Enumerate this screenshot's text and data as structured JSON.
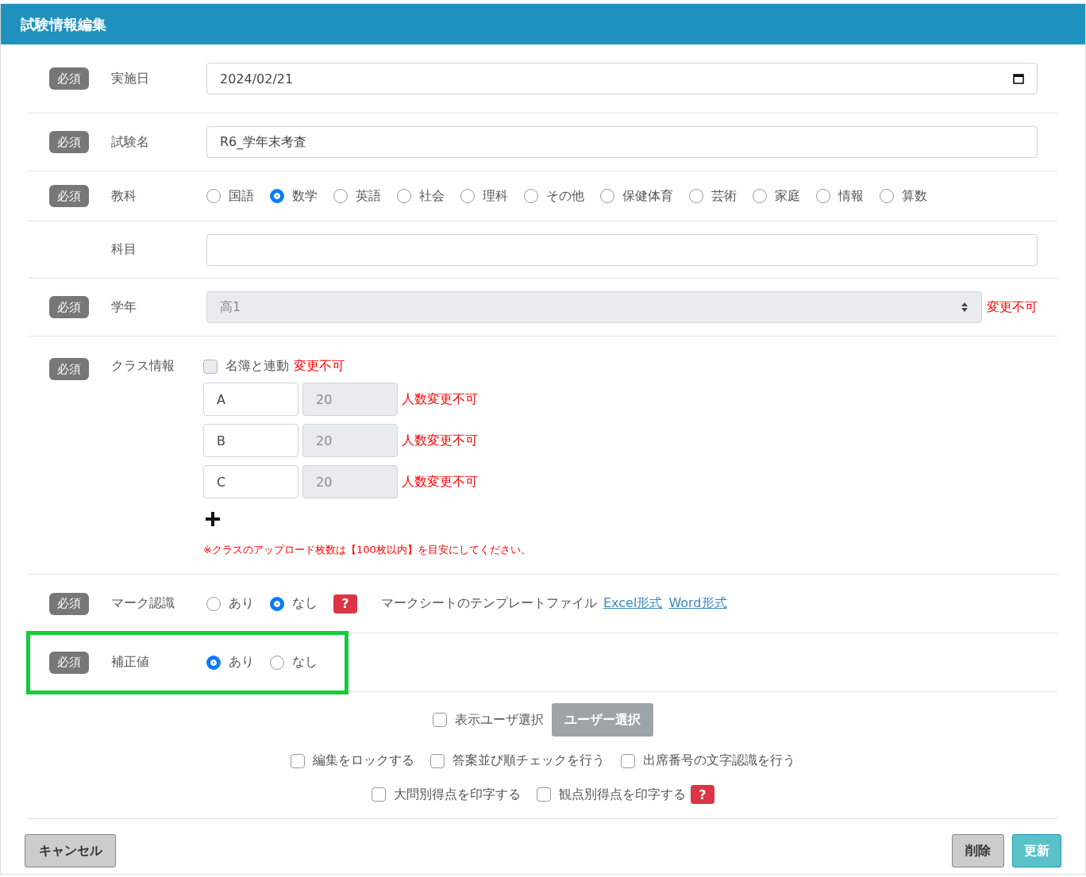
{
  "title": "試験情報編集",
  "fields": [
    {
      "kind": "date",
      "required_label": "必須",
      "label": "実施日",
      "value": "2024/02/21"
    },
    {
      "kind": "text",
      "required_label": "必須",
      "label": "試験名",
      "value": "R6_学年末考査"
    },
    {
      "kind": "radio",
      "required_label": "必須",
      "label": "教科",
      "options": [
        {
          "label": "国語",
          "selected": false
        },
        {
          "label": "数学",
          "selected": true
        },
        {
          "label": "英語",
          "selected": false
        },
        {
          "label": "社会",
          "selected": false
        },
        {
          "label": "理科",
          "selected": false
        },
        {
          "label": "その他",
          "selected": false
        },
        {
          "label": "保健体育",
          "selected": false
        },
        {
          "label": "芸術",
          "selected": false
        },
        {
          "label": "家庭",
          "selected": false
        },
        {
          "label": "情報",
          "selected": false
        },
        {
          "label": "算数",
          "selected": false
        }
      ]
    },
    {
      "kind": "text",
      "label": "科目"
    },
    {
      "kind": "select",
      "required_label": "必須",
      "label": "学年",
      "value": "高1",
      "disabled": true,
      "note": "変更不可"
    },
    {
      "kind": "classes",
      "required_label": "必須",
      "label": "クラス情報",
      "link_checkbox": {
        "label": "名簿と連動",
        "checked": false,
        "disabled": true,
        "note": "変更不可"
      },
      "classes": [
        {
          "name": "A",
          "count": "20",
          "count_disabled": true,
          "note": "人数変更不可"
        },
        {
          "name": "B",
          "count": "20",
          "count_disabled": true,
          "note": "人数変更不可"
        },
        {
          "name": "C",
          "count": "20",
          "count_disabled": true,
          "note": "人数変更不可"
        }
      ],
      "notice": "※クラスのアップロード枚数は【100枚以内】を目安にしてください。"
    },
    {
      "kind": "radio",
      "required_label": "必須",
      "label": "マーク認識",
      "options": [
        {
          "label": "あり",
          "selected": false
        },
        {
          "label": "なし",
          "selected": true
        }
      ],
      "help": "?",
      "template_label": "マークシートのテンプレートファイル",
      "links": [
        "Excel形式",
        "Word形式"
      ]
    },
    {
      "kind": "radio",
      "required_label": "必須",
      "label": "補正値",
      "options": [
        {
          "label": "あり",
          "selected": true
        },
        {
          "label": "なし",
          "selected": false
        }
      ],
      "highlighted": true
    }
  ],
  "user_select": {
    "checkbox": {
      "label": "表示ユーザ選択",
      "checked": false
    },
    "button": {
      "label": "ユーザー選択",
      "disabled": true
    }
  },
  "option_rows": [
    [
      {
        "label": "編集をロックする",
        "checked": false
      },
      {
        "label": "答案並び順チェックを行う",
        "checked": false
      },
      {
        "label": "出席番号の文字認識を行う",
        "checked": false
      }
    ],
    [
      {
        "label": "大問別得点を印字する",
        "checked": false
      },
      {
        "label": "観点別得点を印字する",
        "checked": false,
        "help": "?"
      }
    ]
  ],
  "footer": {
    "cancel": "キャンセル",
    "delete": "削除",
    "update": "更新"
  }
}
